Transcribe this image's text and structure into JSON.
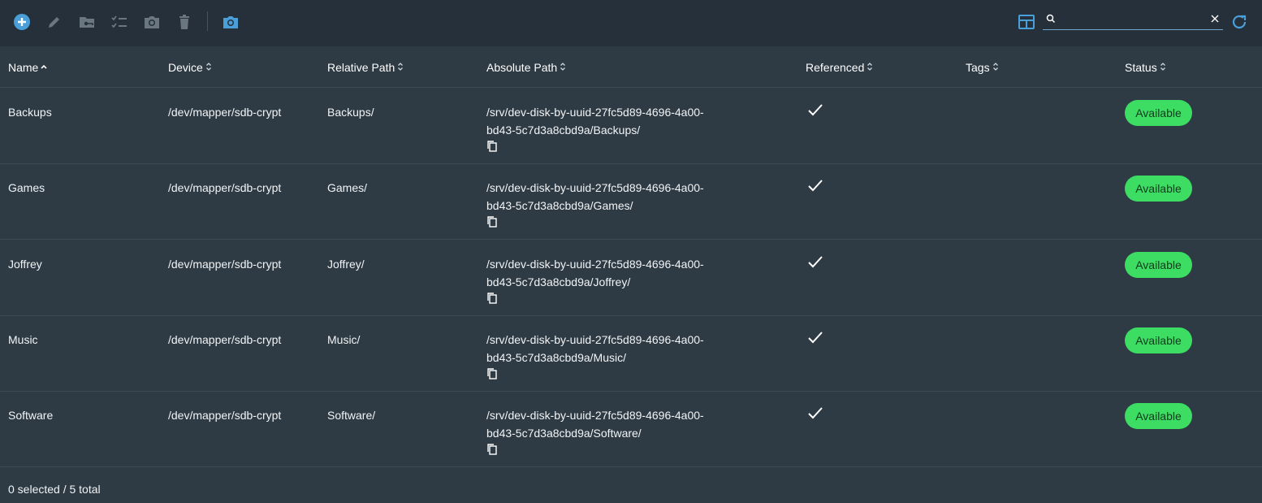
{
  "toolbar": {
    "icons": [
      "plus-circle-icon",
      "pencil-icon",
      "folder-key-icon",
      "list-check-icon",
      "camera-icon",
      "trash-icon",
      "camera-icon"
    ],
    "accent": "#4a9fd8"
  },
  "search": {
    "value": "",
    "placeholder": ""
  },
  "columns": [
    "Name",
    "Device",
    "Relative Path",
    "Absolute Path",
    "Referenced",
    "Tags",
    "Status"
  ],
  "rows": [
    {
      "name": "Backups",
      "device": "/dev/mapper/sdb-crypt",
      "relative_path": "Backups/",
      "absolute_path_line1": "/srv/dev-disk-by-uuid-27fc5d89-4696-4a00-",
      "absolute_path_line2": "bd43-5c7d3a8cbd9a/Backups/",
      "referenced": true,
      "tags": "",
      "status": "Available"
    },
    {
      "name": "Games",
      "device": "/dev/mapper/sdb-crypt",
      "relative_path": "Games/",
      "absolute_path_line1": "/srv/dev-disk-by-uuid-27fc5d89-4696-4a00-",
      "absolute_path_line2": "bd43-5c7d3a8cbd9a/Games/",
      "referenced": true,
      "tags": "",
      "status": "Available"
    },
    {
      "name": "Joffrey",
      "device": "/dev/mapper/sdb-crypt",
      "relative_path": "Joffrey/",
      "absolute_path_line1": "/srv/dev-disk-by-uuid-27fc5d89-4696-4a00-",
      "absolute_path_line2": "bd43-5c7d3a8cbd9a/Joffrey/",
      "referenced": true,
      "tags": "",
      "status": "Available"
    },
    {
      "name": "Music",
      "device": "/dev/mapper/sdb-crypt",
      "relative_path": "Music/",
      "absolute_path_line1": "/srv/dev-disk-by-uuid-27fc5d89-4696-4a00-",
      "absolute_path_line2": "bd43-5c7d3a8cbd9a/Music/",
      "referenced": true,
      "tags": "",
      "status": "Available"
    },
    {
      "name": "Software",
      "device": "/dev/mapper/sdb-crypt",
      "relative_path": "Software/",
      "absolute_path_line1": "/srv/dev-disk-by-uuid-27fc5d89-4696-4a00-",
      "absolute_path_line2": "bd43-5c7d3a8cbd9a/Software/",
      "referenced": true,
      "tags": "",
      "status": "Available"
    }
  ],
  "footer": {
    "summary": "0 selected / 5 total"
  },
  "colors": {
    "status_available": "#3ddc62"
  }
}
